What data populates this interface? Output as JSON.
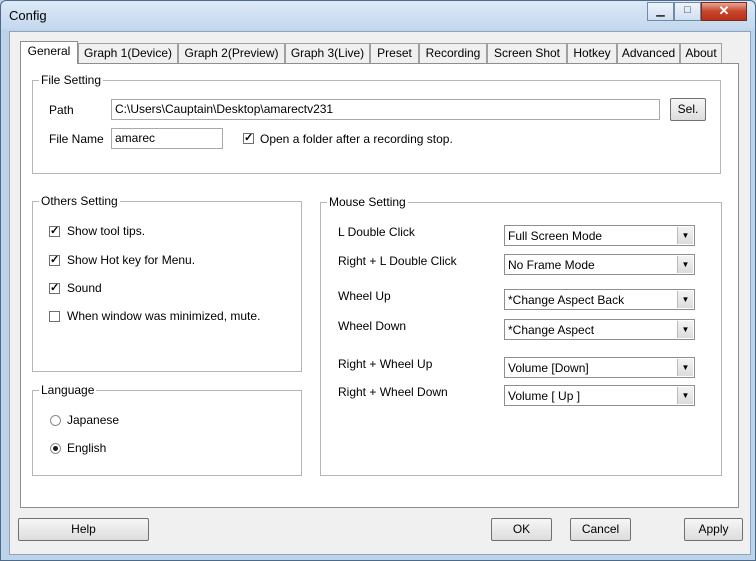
{
  "window": {
    "title": "Config",
    "minimize_glyph": "▁",
    "maximize_glyph": "□",
    "close_glyph": "✕"
  },
  "tabs": [
    {
      "label": "General"
    },
    {
      "label": "Graph 1(Device)"
    },
    {
      "label": "Graph 2(Preview)"
    },
    {
      "label": "Graph 3(Live)"
    },
    {
      "label": "Preset"
    },
    {
      "label": "Recording"
    },
    {
      "label": "Screen Shot"
    },
    {
      "label": "Hotkey"
    },
    {
      "label": "Advanced"
    },
    {
      "label": "About"
    }
  ],
  "file_setting": {
    "legend": "File Setting",
    "path_label": "Path",
    "path_value": "C:\\Users\\Cauptain\\Desktop\\amarectv231",
    "sel_button": "Sel.",
    "file_name_label": "File Name",
    "file_name_value": "amarec",
    "open_folder_label": "Open a folder after a recording stop.",
    "open_folder_checked": true
  },
  "others_setting": {
    "legend": "Others Setting",
    "items": [
      {
        "label": "Show tool tips.",
        "checked": true
      },
      {
        "label": "Show Hot key for Menu.",
        "checked": true
      },
      {
        "label": "Sound",
        "checked": true
      },
      {
        "label": "When window was minimized, mute.",
        "checked": false
      }
    ]
  },
  "language": {
    "legend": "Language",
    "options": [
      {
        "label": "Japanese",
        "selected": false
      },
      {
        "label": "English",
        "selected": true
      }
    ]
  },
  "mouse_setting": {
    "legend": "Mouse Setting",
    "rows": [
      {
        "label": "L Double Click",
        "value": "Full Screen Mode"
      },
      {
        "label": "Right + L Double Click",
        "value": "No Frame Mode"
      },
      {
        "label": "Wheel Up",
        "value": "*Change Aspect Back"
      },
      {
        "label": "Wheel Down",
        "value": "*Change Aspect"
      },
      {
        "label": "Right + Wheel Up",
        "value": "Volume [Down]"
      },
      {
        "label": "Right + Wheel Down",
        "value": "Volume [ Up ]"
      }
    ]
  },
  "footer": {
    "help": "Help",
    "ok": "OK",
    "cancel": "Cancel",
    "apply": "Apply"
  },
  "icons": {
    "check_glyph": "✓",
    "dropdown_glyph": "▼"
  }
}
